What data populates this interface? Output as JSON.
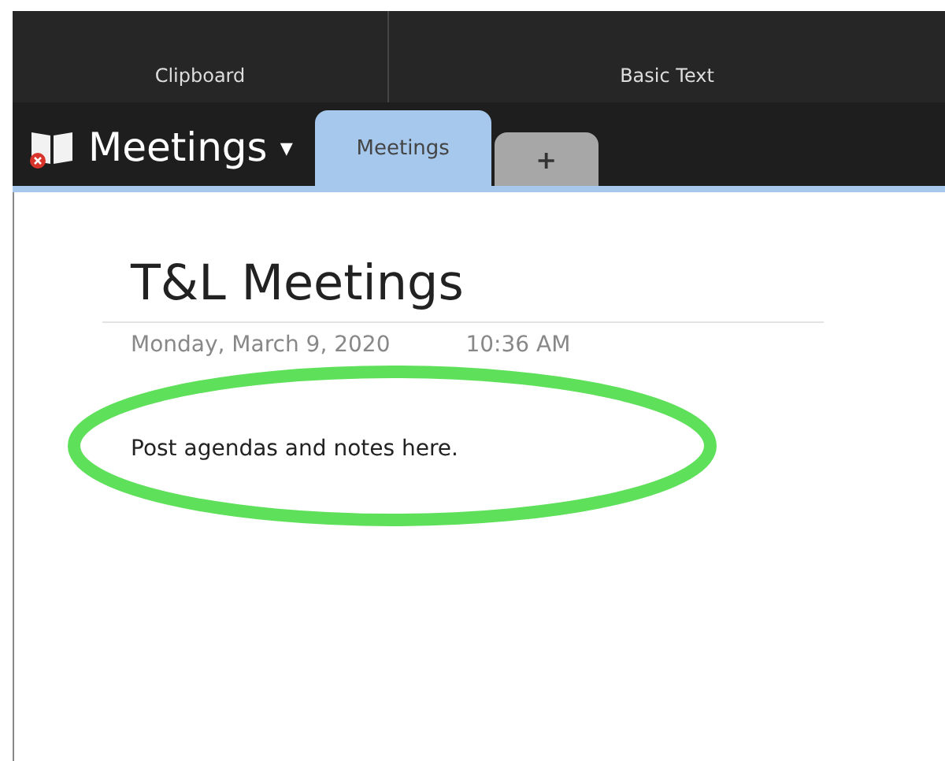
{
  "ribbon": {
    "groups": [
      "Clipboard",
      "Basic Text"
    ]
  },
  "notebook": {
    "title": "Meetings",
    "caret": "▾"
  },
  "tabs": [
    {
      "label": "Meetings",
      "selected": true
    },
    {
      "label": "+",
      "selected": false
    }
  ],
  "page": {
    "title": "T&L Meetings",
    "date": "Monday, March 9, 2020",
    "time": "10:36 AM",
    "body": "Post agendas and notes here."
  }
}
